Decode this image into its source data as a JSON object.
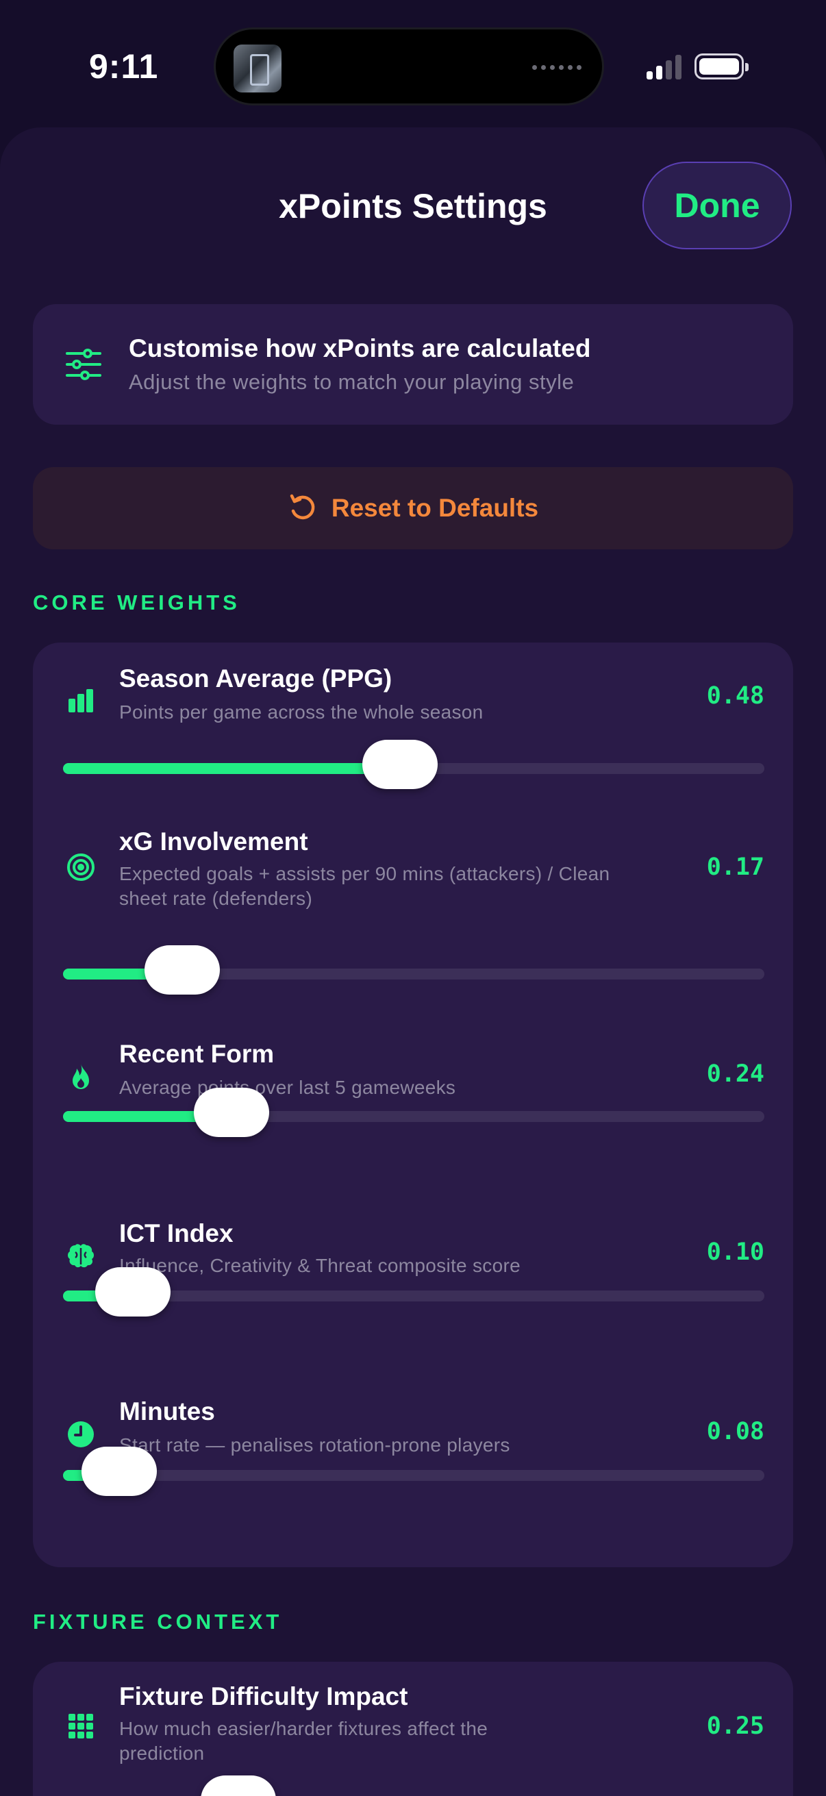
{
  "status": {
    "time": "9:11"
  },
  "sheet": {
    "title": "xPoints Settings",
    "done_label": "Done"
  },
  "info": {
    "icon": "sliders-icon",
    "title": "Customise how xPoints are calculated",
    "subtitle": "Adjust the weights to match your playing style"
  },
  "reset": {
    "icon": "rotate-ccw-icon",
    "label": "Reset to Defaults"
  },
  "colors": {
    "accent": "#21ec84",
    "reset": "#f4883c",
    "background": "#150d2a",
    "card": "#2a1b48"
  },
  "sections": {
    "core": {
      "label": "CORE WEIGHTS",
      "items": [
        {
          "icon": "bar-chart-icon",
          "title": "Season Average (PPG)",
          "subtitle": "Points per game across the whole season",
          "value": "0.48",
          "level": 0.48
        },
        {
          "icon": "target-icon",
          "title": "xG Involvement",
          "subtitle": "Expected goals + assists per 90 mins (attackers) / Clean sheet rate (defenders)",
          "value": "0.17",
          "level": 0.17
        },
        {
          "icon": "flame-icon",
          "title": "Recent Form",
          "subtitle": "Average points over last 5 gameweeks",
          "value": "0.24",
          "level": 0.24
        },
        {
          "icon": "brain-icon",
          "title": "ICT Index",
          "subtitle": "Influence, Creativity & Threat composite score",
          "value": "0.10",
          "level": 0.1
        },
        {
          "icon": "clock-icon",
          "title": "Minutes",
          "subtitle": "Start rate — penalises rotation-prone players",
          "value": "0.08",
          "level": 0.08
        }
      ]
    },
    "fixture": {
      "label": "FIXTURE CONTEXT",
      "items": [
        {
          "icon": "grid-icon",
          "title": "Fixture Difficulty Impact",
          "subtitle": "How much easier/harder fixtures affect the prediction",
          "value": "0.25",
          "level": 0.25
        }
      ]
    }
  }
}
